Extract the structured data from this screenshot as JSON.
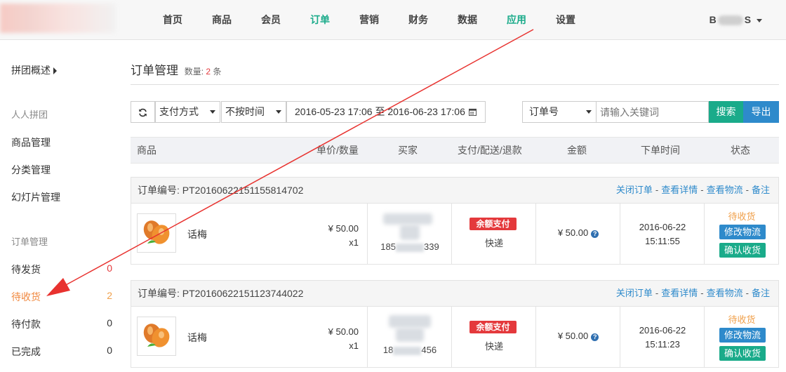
{
  "nav": {
    "items": [
      "首页",
      "商品",
      "会员",
      "订单",
      "营销",
      "财务",
      "数据",
      "应用",
      "设置"
    ],
    "user": {
      "prefix": "B",
      "suffix": "S"
    }
  },
  "sidebar": {
    "overview": "拼团概述",
    "section1": "人人拼团",
    "section1_items": [
      "商品管理",
      "分类管理",
      "幻灯片管理"
    ],
    "section2": "订单管理",
    "orders": [
      {
        "label": "待发货",
        "count": "0"
      },
      {
        "label": "待收货",
        "count": "2"
      },
      {
        "label": "待付款",
        "count": "0"
      },
      {
        "label": "已完成",
        "count": "0"
      }
    ]
  },
  "page": {
    "title": "订单管理",
    "count_prefix": "数量:",
    "count": "2",
    "count_suffix": "条"
  },
  "filters": {
    "payment": "支付方式",
    "time_mode": "不按时间",
    "date_range": "2016-05-23 17:06 至 2016-06-23 17:06",
    "field": "订单号",
    "search_placeholder": "请输入关键词",
    "search_btn": "搜索",
    "export_btn": "导出"
  },
  "table": {
    "headers": {
      "product": "商品",
      "price_qty": "单价/数量",
      "buyer": "买家",
      "pay_ship": "支付/配送/退款",
      "amount": "金额",
      "time": "下单时间",
      "status": "状态"
    }
  },
  "orders": [
    {
      "order_no": "订单编号: PT20160622151155814702",
      "links": [
        "关闭订单",
        "查看详情",
        "查看物流",
        "备注"
      ],
      "product": "话梅",
      "price": "¥ 50.00",
      "qty": "x1",
      "buyer_phone_head": "185",
      "buyer_phone_tail": "339",
      "pay_badge": "余额支付",
      "ship": "快递",
      "amount": "¥ 50.00",
      "date": "2016-06-22",
      "time": "15:11:55",
      "status": "待收货",
      "btn_logistics": "修改物流",
      "btn_confirm": "确认收货"
    },
    {
      "order_no": "订单编号: PT20160622151123744022",
      "links": [
        "关闭订单",
        "查看详情",
        "查看物流",
        "备注"
      ],
      "product": "话梅",
      "price": "¥ 50.00",
      "qty": "x1",
      "buyer_phone_head": "18",
      "buyer_phone_tail": "456",
      "pay_badge": "余额支付",
      "ship": "快递",
      "amount": "¥ 50.00",
      "date": "2016-06-22",
      "time": "15:11:23",
      "status": "待收货",
      "btn_logistics": "修改物流",
      "btn_confirm": "确认收货"
    }
  ],
  "colors": {
    "accent_green": "#1aab8a",
    "link_blue": "#2e8acb",
    "badge_red": "#e4393c",
    "pending_orange": "#f0a04b",
    "annotation_arrow": "#e8322f"
  }
}
